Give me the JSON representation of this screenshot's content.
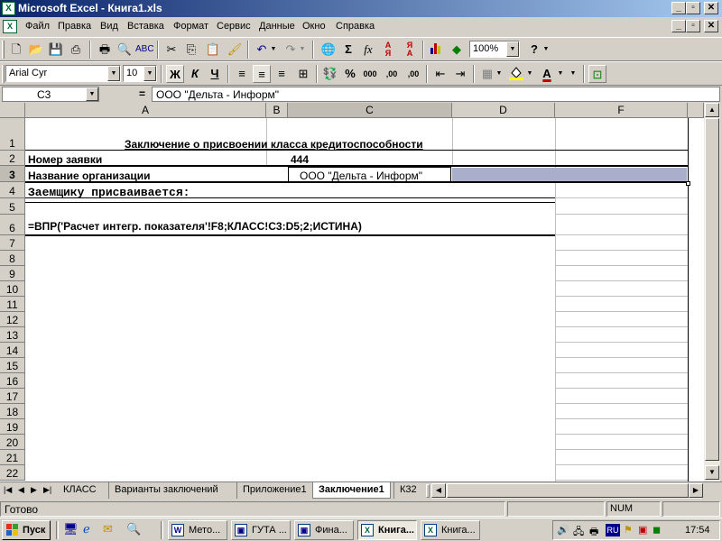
{
  "window": {
    "title": "Microsoft Excel - Книга1.xls",
    "minimize": "_",
    "restore": "▫",
    "close": "✕"
  },
  "menu": {
    "items": [
      "Файл",
      "Правка",
      "Вид",
      "Вставка",
      "Формат",
      "Сервис",
      "Данные",
      "Окно",
      "Справка"
    ],
    "doc_minimize": "_",
    "doc_restore": "▫",
    "doc_close": "✕"
  },
  "toolbar_standard": {
    "zoom": "100%",
    "icons": [
      "new-icon",
      "open-icon",
      "save-icon",
      "permission-icon",
      "print-icon",
      "print-preview-icon",
      "spelling-icon",
      "cut-icon",
      "copy-icon",
      "paste-icon",
      "format-painter-icon",
      "undo-icon",
      "redo-icon",
      "hyperlink-icon",
      "autosum-icon",
      "function-icon",
      "sort-ascending-icon",
      "sort-descending-icon",
      "chart-wizard-icon",
      "drawing-icon",
      "help-icon"
    ]
  },
  "toolbar_format": {
    "font": "Arial Cyr",
    "size": "10",
    "bold_label": "Ж",
    "italic_label": "К",
    "underline_label": "Ч",
    "percent_label": "%",
    "thousands_label": "000",
    "inc_decimal_label": "‚00",
    "dec_decimal_label": ",00"
  },
  "formula_bar": {
    "name_box": "C3",
    "equals": "=",
    "content": "ООО \"Дельта - Информ\""
  },
  "sheet": {
    "columns": [
      "A",
      "B",
      "C",
      "D",
      "F"
    ],
    "rows": [
      "1",
      "2",
      "3",
      "4",
      "5",
      "6",
      "7",
      "8",
      "9",
      "10",
      "11",
      "12",
      "13",
      "14",
      "15",
      "16",
      "17",
      "18",
      "19",
      "20",
      "21",
      "22"
    ],
    "cells": {
      "title": "Заключение о присвоении класса кредитоспособности",
      "a2": "Номер заявки",
      "c2": "444",
      "a3": "Название организации",
      "c3": "ООО \"Дельта - Информ\"",
      "a4": "Заемщику присваивается:",
      "a6": "=ВПР('Расчет интегр. показателя'!F8;КЛАСС!C3:D5;2;ИСТИНА)"
    }
  },
  "tabs": {
    "items": [
      "КЛАСС",
      "Варианты заключений",
      "Приложение1",
      "Заключение1",
      "К32"
    ],
    "active": "Заключение1"
  },
  "status": {
    "text": "Готово",
    "num": "NUM"
  },
  "taskbar": {
    "start": "Пуск",
    "tasks": [
      "Мето...",
      "ГУТА ...",
      "Фина...",
      "Книга...",
      "Книга..."
    ],
    "lang": "RU",
    "time": "17:54"
  },
  "colors": {
    "titlebar_start": "#0a246a",
    "titlebar_end": "#a6caf0",
    "face": "#d4d0c8",
    "selection_fill": "#a9aeca"
  }
}
